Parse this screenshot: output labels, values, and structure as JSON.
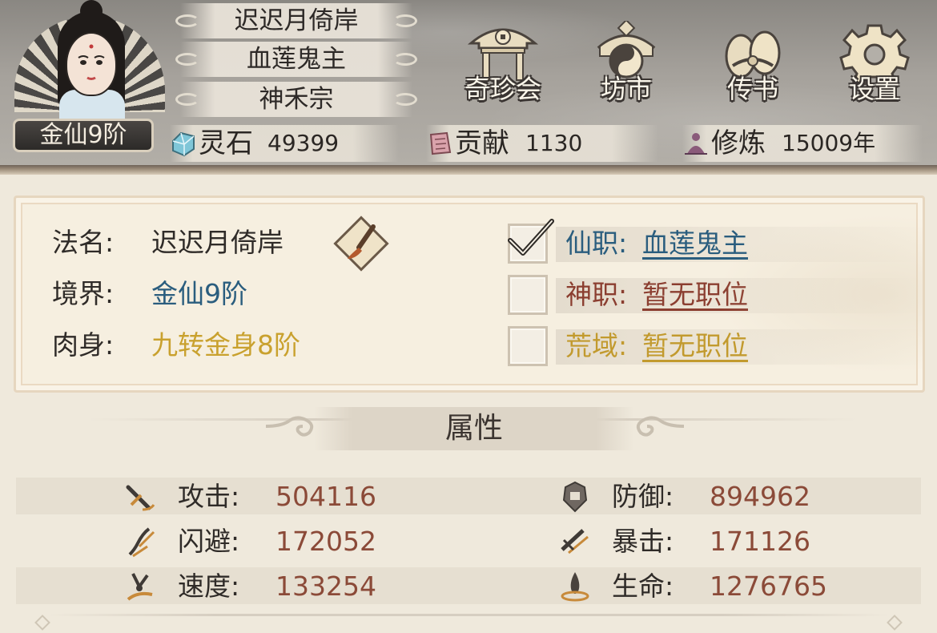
{
  "player": {
    "name": "迟迟月倚岸",
    "title": "血莲鬼主",
    "sect": "神禾宗",
    "realm_badge": "金仙9阶"
  },
  "menu": [
    {
      "id": "treasure",
      "label": "奇珍会",
      "icon": "pavilion-icon"
    },
    {
      "id": "market",
      "label": "坊市",
      "icon": "yin-yang-gate-icon"
    },
    {
      "id": "letters",
      "label": "传书",
      "icon": "scroll-icon"
    },
    {
      "id": "settings",
      "label": "设置",
      "icon": "gear-icon"
    }
  ],
  "resources": [
    {
      "id": "spirit-stone",
      "label": "灵石",
      "value": "49399",
      "icon": "spirit-stone-icon",
      "color": "#7fc6d8"
    },
    {
      "id": "contribution",
      "label": "贡献",
      "value": "1130",
      "icon": "contribution-icon",
      "color": "#c98b96"
    },
    {
      "id": "cultivation",
      "label": "修炼",
      "value": "15009年",
      "icon": "meditation-icon",
      "color": "#8a5a7a"
    }
  ],
  "info": {
    "dharma_name_label": "法名:",
    "dharma_name": "迟迟月倚岸",
    "realm_label": "境界:",
    "realm": "金仙9阶",
    "body_label": "肉身:",
    "body": "九转金身8阶"
  },
  "positions": [
    {
      "id": "immortal",
      "label": "仙职:",
      "value": "血莲鬼主",
      "checked": true,
      "label_color": "#2a5d7e",
      "value_color": "#2a5d7e"
    },
    {
      "id": "divine",
      "label": "神职:",
      "value": "暂无职位",
      "checked": false,
      "label_color": "#8b3e30",
      "value_color": "#8b3e30"
    },
    {
      "id": "wild",
      "label": "荒域:",
      "value": "暂无职位",
      "checked": false,
      "label_color": "#c29a2e",
      "value_color": "#c29a2e"
    }
  ],
  "attributes_title": "属性",
  "attributes": [
    {
      "id": "attack",
      "label": "攻击:",
      "value": "504116",
      "icon": "sword-icon"
    },
    {
      "id": "defense",
      "label": "防御:",
      "value": "894962",
      "icon": "shield-icon"
    },
    {
      "id": "dodge",
      "label": "闪避:",
      "value": "172052",
      "icon": "dash-icon"
    },
    {
      "id": "crit",
      "label": "暴击:",
      "value": "171126",
      "icon": "crit-icon"
    },
    {
      "id": "speed",
      "label": "速度:",
      "value": "133254",
      "icon": "speed-icon"
    },
    {
      "id": "hp",
      "label": "生命:",
      "value": "1276765",
      "icon": "life-icon"
    }
  ],
  "colors": {
    "realm_text": "#2a5d7e",
    "body_text": "#c9a12e",
    "attr_value": "#8b4a38"
  }
}
